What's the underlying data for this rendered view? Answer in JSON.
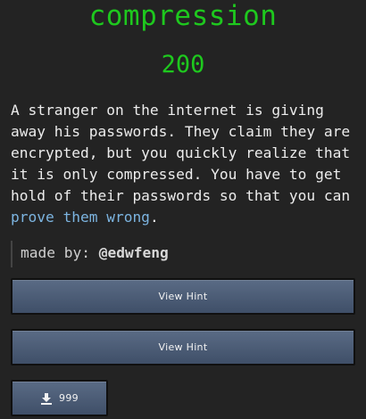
{
  "challenge": {
    "title": "compression",
    "points": "200",
    "description_parts": {
      "text": "A stranger on the internet is giving away his passwords. They claim they are encrypted, but you quickly realize that it is only compressed. You have to get hold of their passwords so that you can ",
      "link": "prove them wrong",
      "end": "."
    },
    "author": {
      "prefix": "made by: ",
      "handle": "@edwfeng"
    }
  },
  "buttons": {
    "hint_1": "View Hint",
    "hint_2": "View Hint",
    "download_count": "999"
  },
  "icons": {
    "download": "download-icon"
  },
  "colors": {
    "background": "#232323",
    "title": "#1ec81e",
    "link": "#7cb4e0",
    "button": "#4b5c77"
  }
}
